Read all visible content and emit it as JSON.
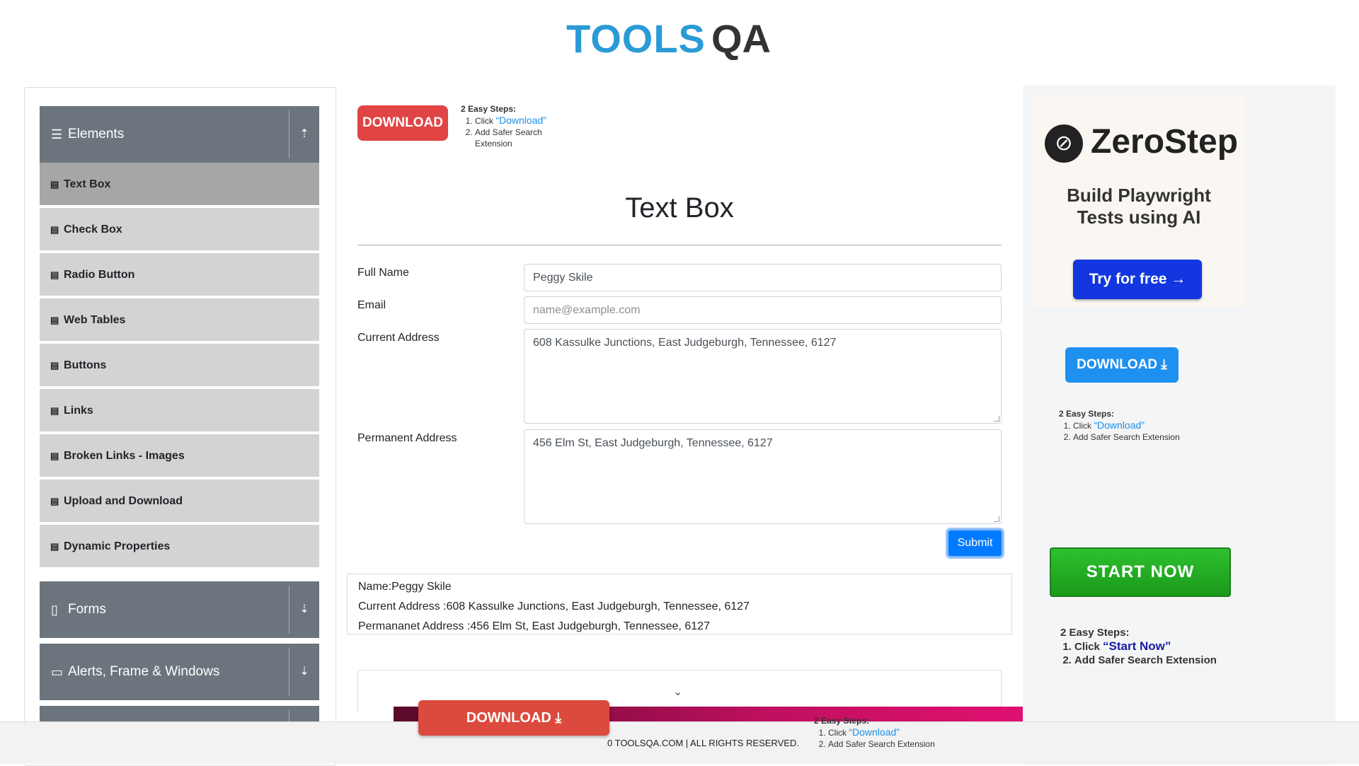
{
  "header": {
    "logo_text_main": "TOOLS",
    "logo_text_qa": "QA"
  },
  "sidebar": {
    "groups": [
      {
        "label": "Elements",
        "icon": "hamburger-icon",
        "toggle_icon": "upload-arrow-icon"
      },
      {
        "label": "Forms",
        "icon": "document-icon",
        "toggle_icon": "download-arrow-icon"
      },
      {
        "label": "Alerts, Frame & Windows",
        "icon": "window-icon",
        "toggle_icon": "download-arrow-icon"
      }
    ],
    "items": [
      {
        "label": "Text Box"
      },
      {
        "label": "Check Box"
      },
      {
        "label": "Radio Button"
      },
      {
        "label": "Web Tables"
      },
      {
        "label": "Buttons"
      },
      {
        "label": "Links"
      },
      {
        "label": "Broken Links - Images"
      },
      {
        "label": "Upload and Download"
      },
      {
        "label": "Dynamic Properties"
      }
    ]
  },
  "ad_top": {
    "button": "DOWNLOAD",
    "steps_title": "2 Easy Steps:",
    "step1_prefix": "Click ",
    "step1_link": "“Download”",
    "step2_line1": "Add Safer Search",
    "step2_line2": "Extension"
  },
  "main": {
    "title": "Text Box",
    "full_name_label": "Full Name",
    "full_name_value": "Peggy Skile",
    "email_label": "Email",
    "email_placeholder": "name@example.com",
    "current_address_label": "Current Address",
    "current_address_value": "608 Kassulke Junctions, East Judgeburgh, Tennessee, 6127",
    "permanent_address_label": "Permanent Address",
    "permanent_address_value": "456 Elm St, East Judgeburgh, Tennessee, 6127",
    "submit_label": "Submit",
    "output_name": "Name:Peggy Skile",
    "output_current": "Current Address :608 Kassulke Junctions, East Judgeburgh, Tennessee, 6127",
    "output_permanent": "Permananet Address :456 Elm St, East Judgeburgh, Tennessee, 6127"
  },
  "right_ad": {
    "brand": "ZeroStep",
    "tagline_line1": "Build Playwright",
    "tagline_line2": "Tests using AI",
    "cta": "Try for free →",
    "download_btn": "DOWNLOAD",
    "steps_title": "2 Easy Steps:",
    "step1_prefix": "Click ",
    "step1_link": "“Download”",
    "step2": "Add Safer Search Extension",
    "start_now": "START NOW",
    "steps2_title": "2 Easy Steps:",
    "steps2_step1_prefix": "Click ",
    "steps2_step1_link": "“Start Now”",
    "steps2_step2": "Add Safer Search Extension"
  },
  "footer": {
    "copyright": "0 TOOLSQA.COM | ALL RIGHTS RESERVED.",
    "download_btn": "DOWNLOAD",
    "steps_title": "2 Easy Steps:",
    "step1_prefix": "Click ",
    "step1_link": "“Download”",
    "step2": "Add Safer Search Extension"
  },
  "colors": {
    "accent": "#007bff",
    "sidebar_header": "#6c757d",
    "sidebar_item": "#d3d3d3",
    "sidebar_active": "#a6a6a6"
  }
}
